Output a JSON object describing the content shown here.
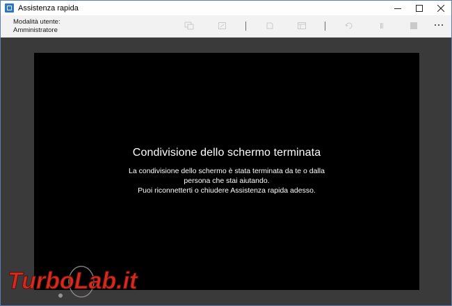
{
  "window": {
    "title": "Assistenza rapida",
    "icon": "quick-assist-icon"
  },
  "toolbar": {
    "user_mode_line1": "Modalità utente:",
    "user_mode_line2": "Amministratore",
    "tools": [
      {
        "name": "select-monitor-icon"
      },
      {
        "name": "annotate-icon"
      },
      {
        "name": "fit-screen-icon"
      },
      {
        "name": "task-manager-icon"
      },
      {
        "name": "reconnect-icon"
      },
      {
        "name": "pause-icon"
      },
      {
        "name": "stop-icon"
      }
    ],
    "more_icon": "more-options-icon"
  },
  "message": {
    "title": "Condivisione dello schermo terminata",
    "line1": "La condivisione dello schermo è stata terminata da te o dalla",
    "line2": "persona che stai aiutando.",
    "line3": "Puoi riconnetterti o chiudere Assistenza rapida adesso."
  },
  "watermark": {
    "text": "TurboLab.it"
  },
  "colors": {
    "background": "#3a3a3a",
    "remote_view": "#000000",
    "toolbar": "#f2f2f2",
    "accent": "#2a77c9",
    "watermark_red": "#d42a1f"
  }
}
